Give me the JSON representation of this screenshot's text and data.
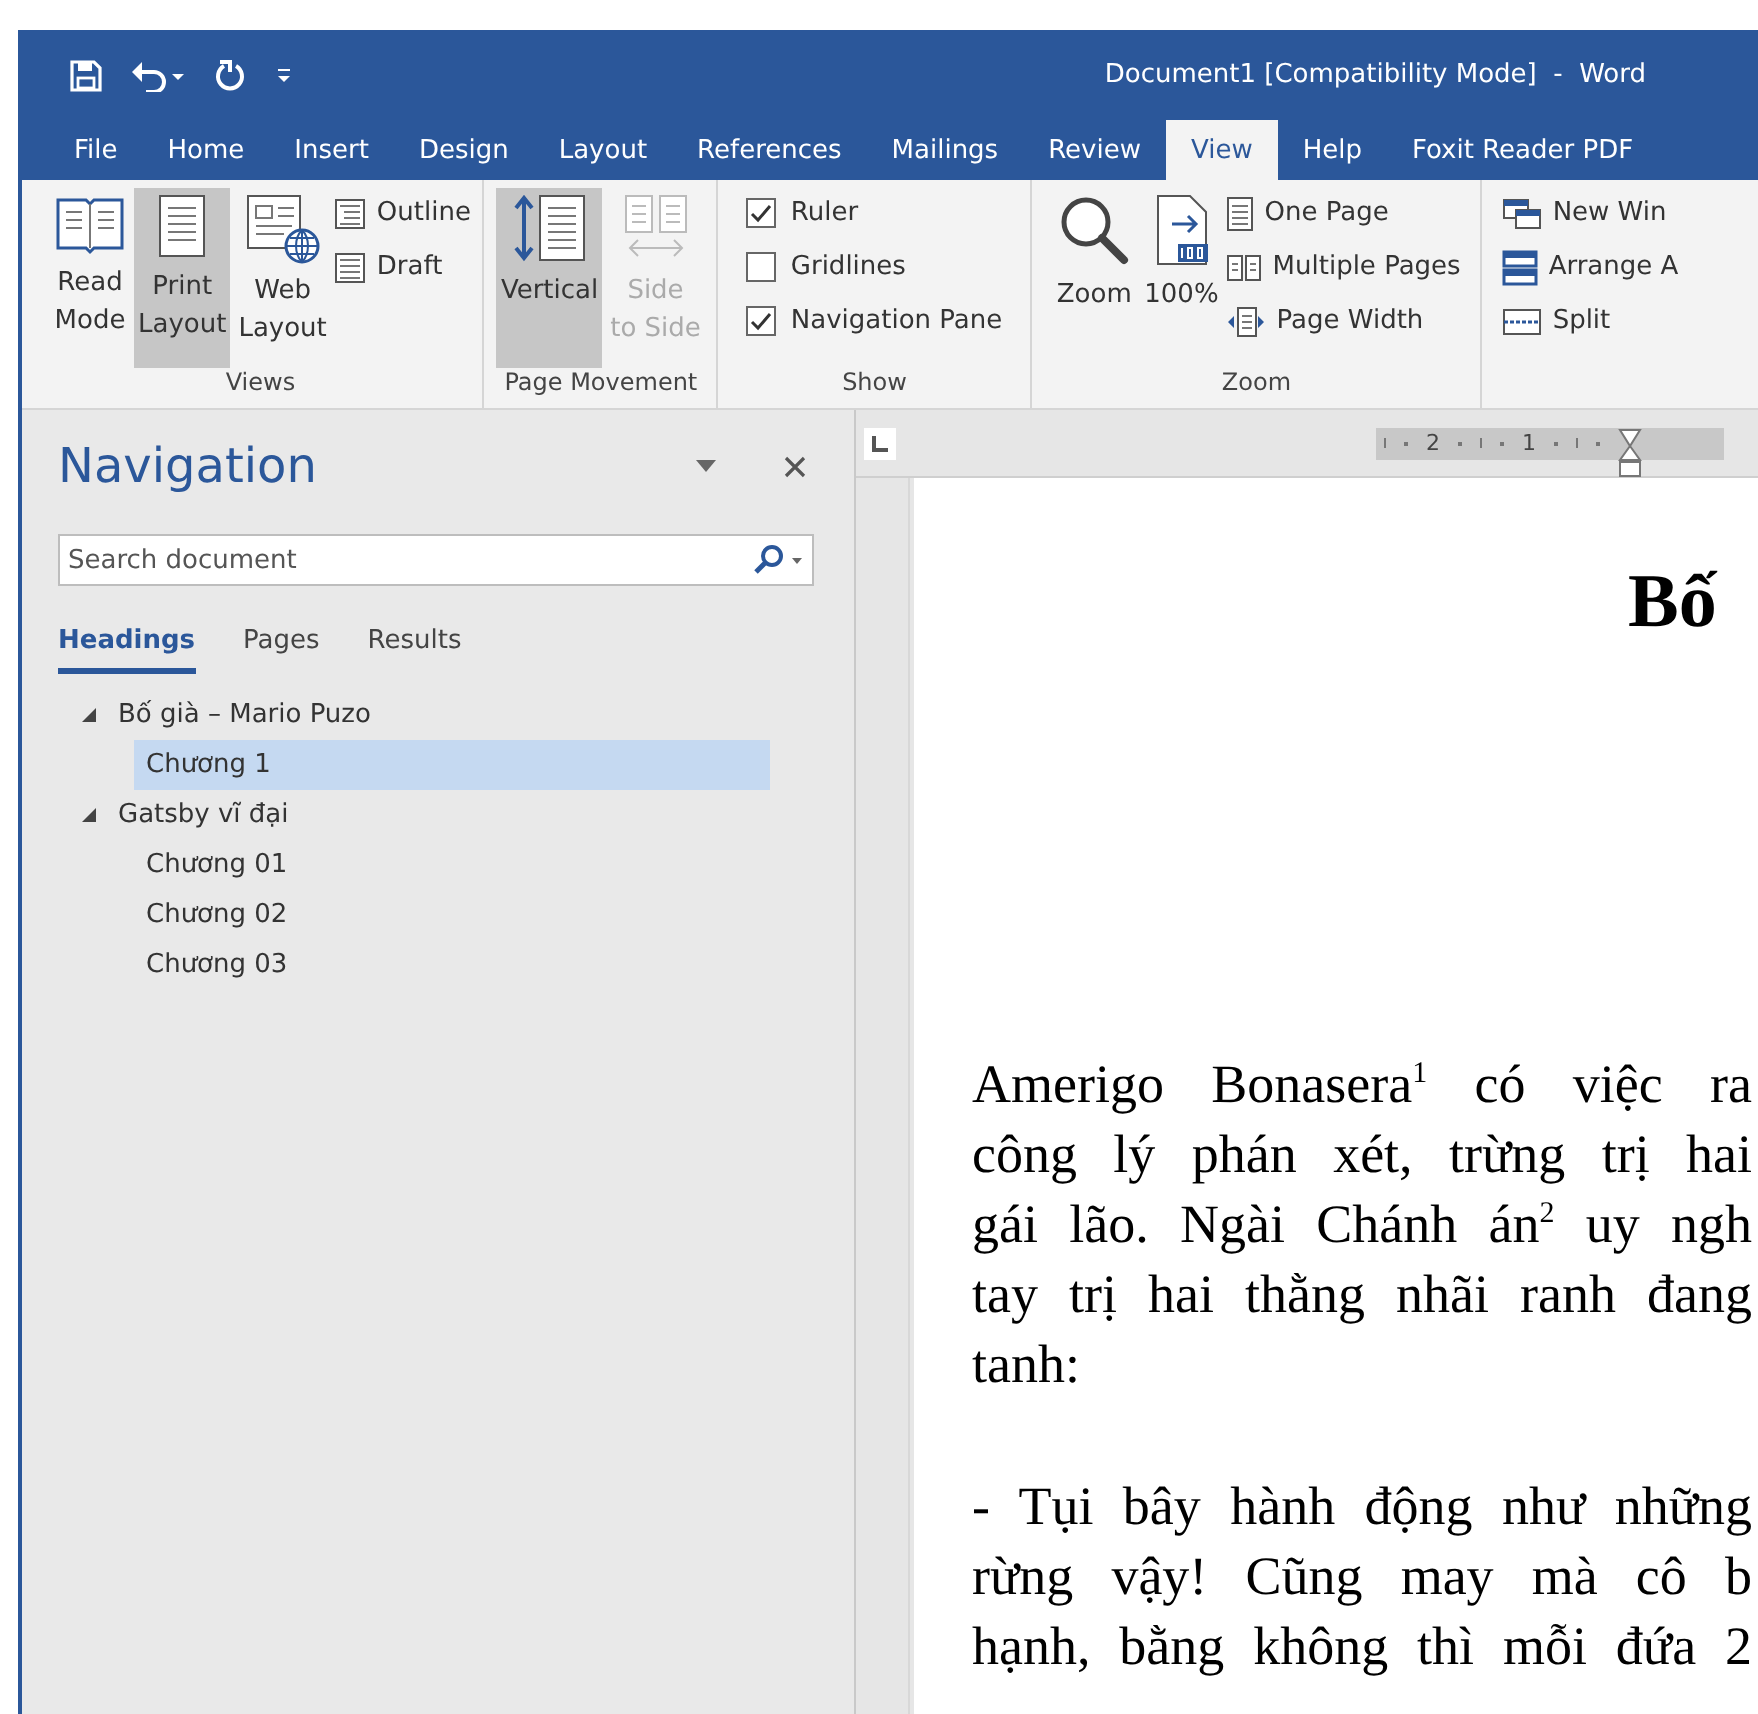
{
  "window": {
    "title": "Document1 [Compatibility Mode]  -  Word"
  },
  "tabs": [
    {
      "label": "File",
      "selected": false
    },
    {
      "label": "Home",
      "selected": false
    },
    {
      "label": "Insert",
      "selected": false
    },
    {
      "label": "Design",
      "selected": false
    },
    {
      "label": "Layout",
      "selected": false
    },
    {
      "label": "References",
      "selected": false
    },
    {
      "label": "Mailings",
      "selected": false
    },
    {
      "label": "Review",
      "selected": false
    },
    {
      "label": "View",
      "selected": true
    },
    {
      "label": "Help",
      "selected": false
    },
    {
      "label": "Foxit Reader PDF",
      "selected": false
    }
  ],
  "ribbon": {
    "views": {
      "label": "Views",
      "large": [
        {
          "label": "Read\nMode",
          "selected": false
        },
        {
          "label": "Print\nLayout",
          "selected": true
        },
        {
          "label": "Web\nLayout",
          "selected": false
        }
      ],
      "small": [
        "Outline",
        "Draft"
      ]
    },
    "page_movement": {
      "label": "Page Movement",
      "large": [
        {
          "label": "Vertical",
          "selected": true,
          "disabled": false
        },
        {
          "label": "Side\nto Side",
          "selected": false,
          "disabled": true
        }
      ]
    },
    "show": {
      "label": "Show",
      "checks": [
        {
          "label": "Ruler",
          "checked": true
        },
        {
          "label": "Gridlines",
          "checked": false
        },
        {
          "label": "Navigation Pane",
          "checked": true
        }
      ]
    },
    "zoom": {
      "label": "Zoom",
      "large": [
        "Zoom",
        "100%"
      ],
      "small": [
        "One Page",
        "Multiple Pages",
        "Page Width"
      ]
    },
    "window_group": {
      "small": [
        "New Win",
        "Arrange A",
        "Split"
      ]
    }
  },
  "navigation": {
    "title": "Navigation",
    "search": {
      "placeholder": "Search document"
    },
    "tabs": [
      {
        "label": "Headings",
        "selected": true
      },
      {
        "label": "Pages",
        "selected": false
      },
      {
        "label": "Results",
        "selected": false
      }
    ],
    "headings": [
      {
        "label": "Bố già – Mario Puzo",
        "selected": false,
        "expanded": true,
        "children": [
          {
            "label": "Chương 1",
            "selected": true
          }
        ]
      },
      {
        "label": "Gatsby vĩ đại",
        "selected": false,
        "expanded": true,
        "children": [
          {
            "label": "Chương 01",
            "selected": false
          },
          {
            "label": "Chương 02",
            "selected": false
          },
          {
            "label": "Chương 03",
            "selected": false
          }
        ]
      }
    ]
  },
  "document": {
    "ruler": [
      "2",
      "1"
    ],
    "title": "Bố",
    "paragraphs": [
      {
        "lines": [
          "Amerigo Bonasera$^{1}$ có việc ra",
          "công lý phán xét, trừng trị hai",
          "gái lão. Ngài Chánh án$^{2}$ uy ngh",
          "tay trị hai thằng nhãi ranh đang",
          "tanh:"
        ]
      },
      {
        "lines": [
          "- Tụi bây hành động như những",
          "rừng vậy! Cũng may mà cô b",
          "hạnh, bằng không thì mỗi đứa 2"
        ]
      }
    ]
  }
}
